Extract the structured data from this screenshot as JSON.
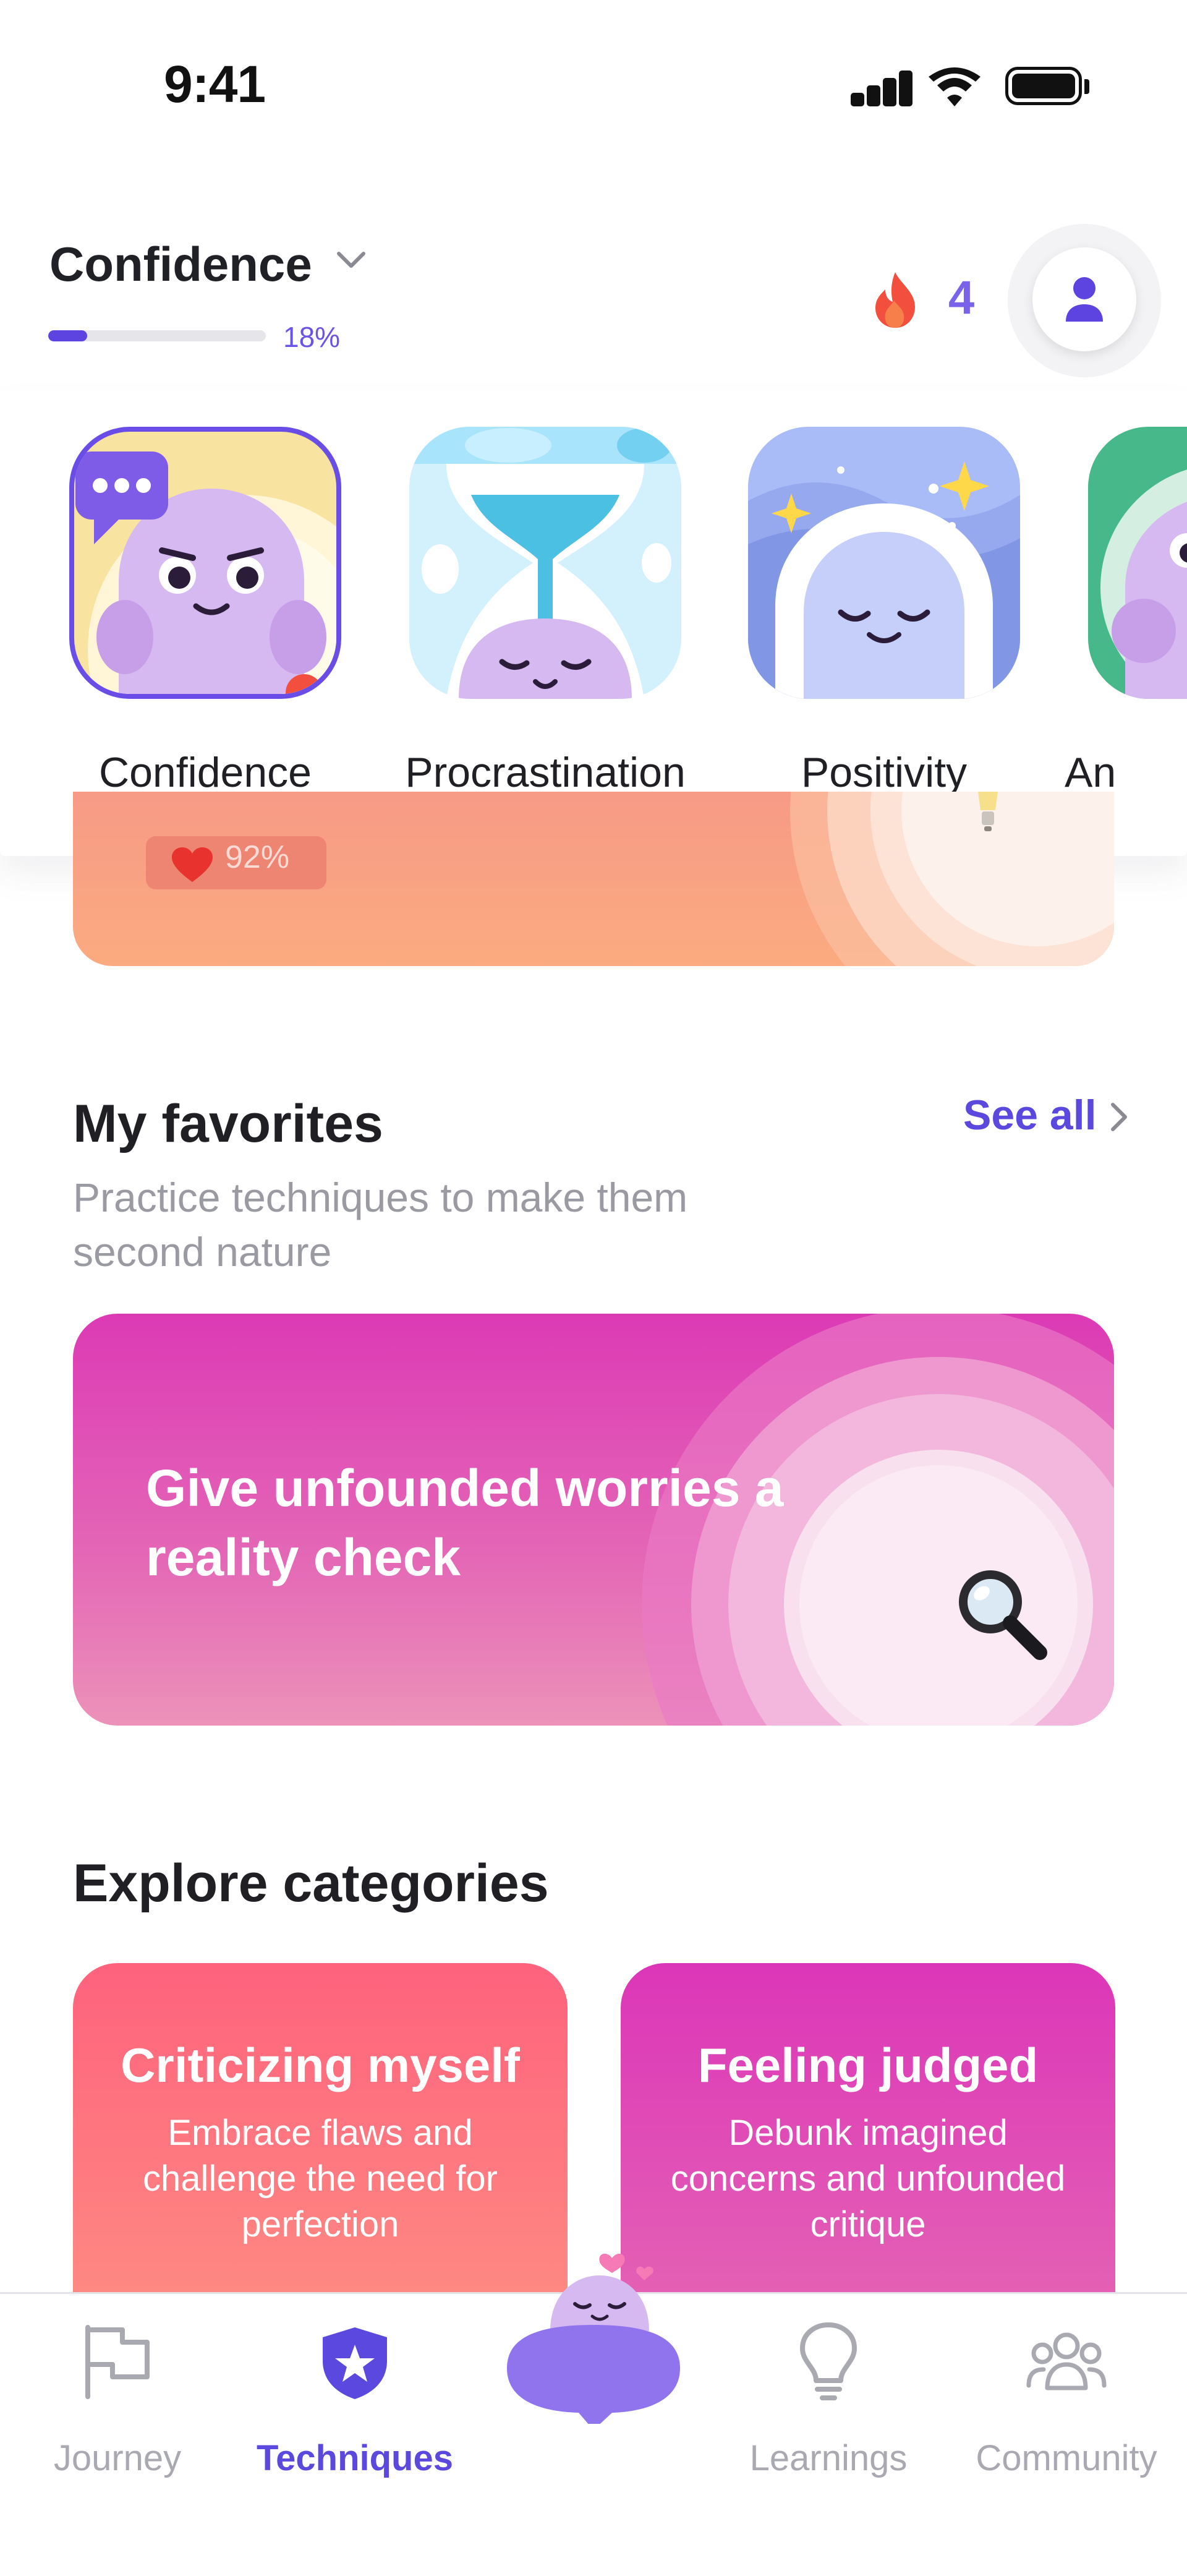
{
  "status_bar": {
    "time": "9:41"
  },
  "header": {
    "goal_title": "Confidence",
    "progress_percent": 18,
    "progress_label": "18%",
    "streak_count": "4",
    "accent_color": "#5d43e0"
  },
  "topics": [
    {
      "label": "Confidence",
      "selected": true
    },
    {
      "label": "Procrastination",
      "selected": false
    },
    {
      "label": "Positivity",
      "selected": false
    },
    {
      "label": "An",
      "selected": false
    }
  ],
  "previous_card": {
    "badge_text": "92%"
  },
  "favorites": {
    "title": "My favorites",
    "subtitle": "Practice techniques to make them second nature",
    "see_all_label": "See all",
    "card_title": "Give unfounded worries a reality check",
    "card_icon": "magnifier-icon"
  },
  "categories": {
    "title": "Explore categories",
    "items": [
      {
        "name": "Criticizing myself",
        "description": "Embrace flaws and challenge the need for perfection",
        "color": "#fd6a7f"
      },
      {
        "name": "Feeling judged",
        "description": "Debunk imagined concerns and unfounded critique",
        "color": "#dd3ab8"
      }
    ]
  },
  "tab_bar": {
    "active_tab": "Techniques",
    "tabs": [
      {
        "label": "Journey",
        "icon": "flag-icon"
      },
      {
        "label": "Techniques",
        "icon": "shield-star-icon"
      },
      {
        "label": "",
        "icon": "mascot-chat-icon"
      },
      {
        "label": "Learnings",
        "icon": "lightbulb-icon"
      },
      {
        "label": "Community",
        "icon": "people-icon"
      }
    ]
  }
}
